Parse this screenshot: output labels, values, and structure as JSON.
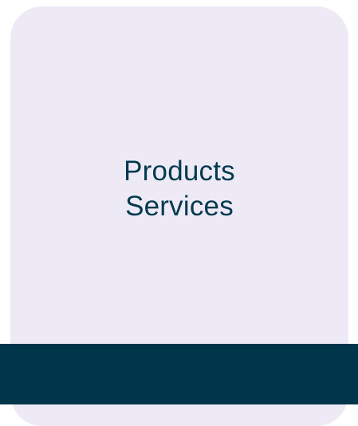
{
  "card": {
    "lines": [
      "Products",
      "Services"
    ],
    "fill_color": "#EEEAF5",
    "text_color": "#023A4F"
  },
  "band": {
    "color": "#01364A"
  }
}
